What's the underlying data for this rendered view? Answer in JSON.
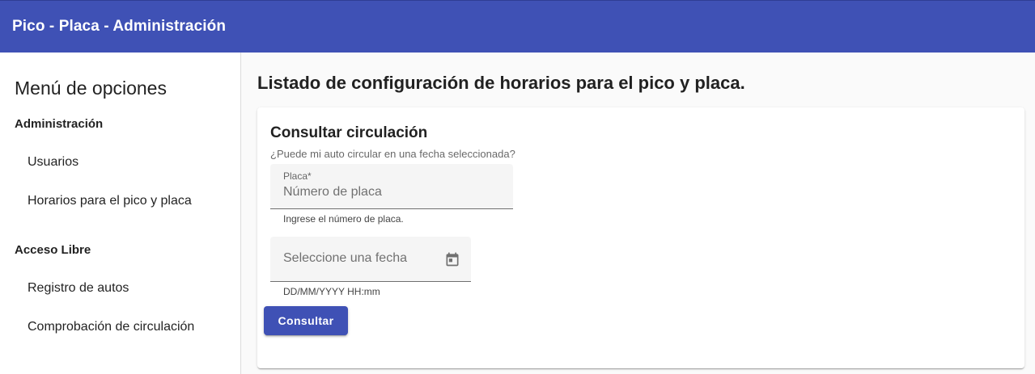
{
  "app": {
    "title": "Pico - Placa - Administración",
    "toolbar_color": "#3f51b5"
  },
  "sidebar": {
    "title": "Menú de opciones",
    "groups": [
      {
        "label": "Administración",
        "items": [
          {
            "label": "Usuarios"
          },
          {
            "label": "Horarios para el pico y placa"
          }
        ]
      },
      {
        "label": "Acceso Libre",
        "items": [
          {
            "label": "Registro de autos"
          },
          {
            "label": "Comprobación de circulación"
          }
        ]
      }
    ]
  },
  "main": {
    "page_title": "Listado de configuración de horarios para el pico y placa.",
    "card": {
      "title": "Consultar circulación",
      "subtitle": "¿Puede mi auto circular en una fecha seleccionada?",
      "plate_field": {
        "label": "Placa*",
        "placeholder": "Número de placa",
        "value": "",
        "hint": "Ingrese el número de placa."
      },
      "date_field": {
        "placeholder": "Seleccione una fecha",
        "value": "",
        "hint": "DD/MM/YYYY HH:mm",
        "icon": "calendar-icon"
      },
      "submit_label": "Consultar",
      "accent": "#3f51b5"
    }
  }
}
